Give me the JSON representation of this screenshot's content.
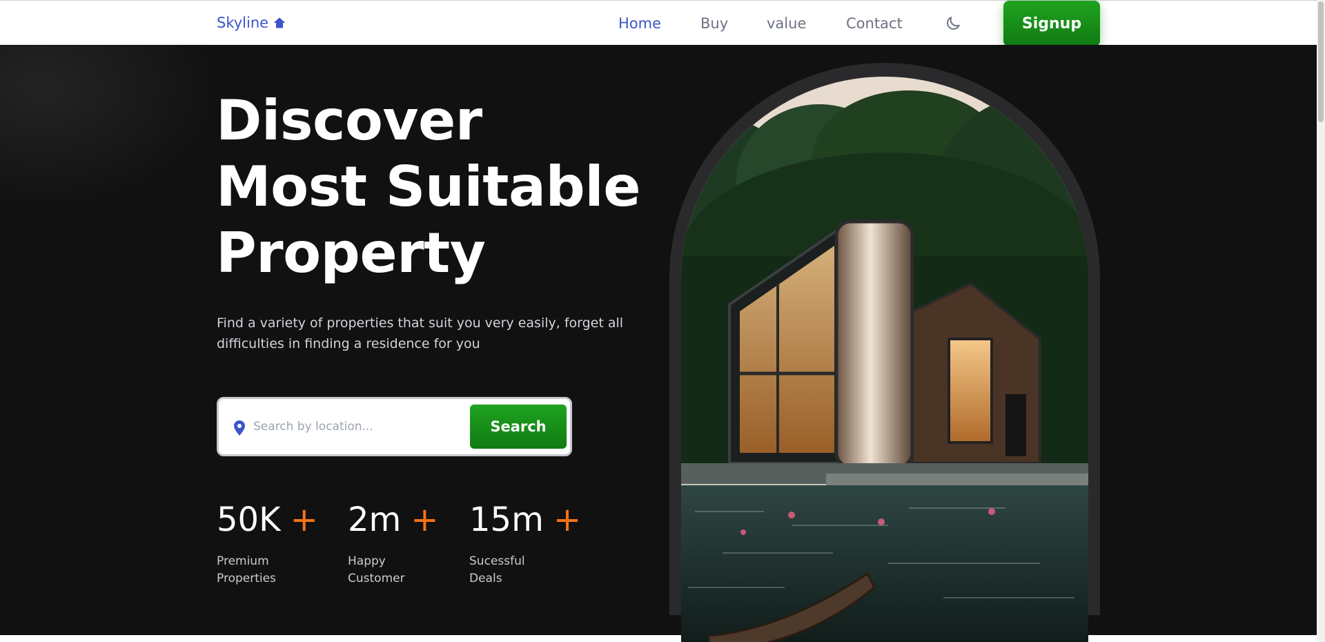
{
  "nav": {
    "logo": "Skyline",
    "links": [
      "Home",
      "Buy",
      "value",
      "Contact"
    ],
    "active": "Home",
    "signup": "Signup"
  },
  "hero": {
    "title_lines": [
      "Discover",
      "Most Suitable",
      "Property"
    ],
    "subtitle": "Find a variety of properties that suit you very easily, forget all difficulties in finding a residence for you",
    "search": {
      "placeholder": "Search by location...",
      "button": "Search"
    },
    "stats": [
      {
        "number": "50K",
        "plus": "+",
        "label": "Premium Properties"
      },
      {
        "number": "2m",
        "plus": "+",
        "label": "Happy Customer"
      },
      {
        "number": "15m",
        "plus": "+",
        "label": "Sucessful Deals"
      }
    ]
  },
  "colors": {
    "brand": "#3b55c8",
    "accent": "#1a9a1a",
    "plus": "#f97316",
    "hero_bg": "#111111"
  },
  "icons": [
    "home-icon",
    "moon-icon",
    "location-pin-icon"
  ]
}
